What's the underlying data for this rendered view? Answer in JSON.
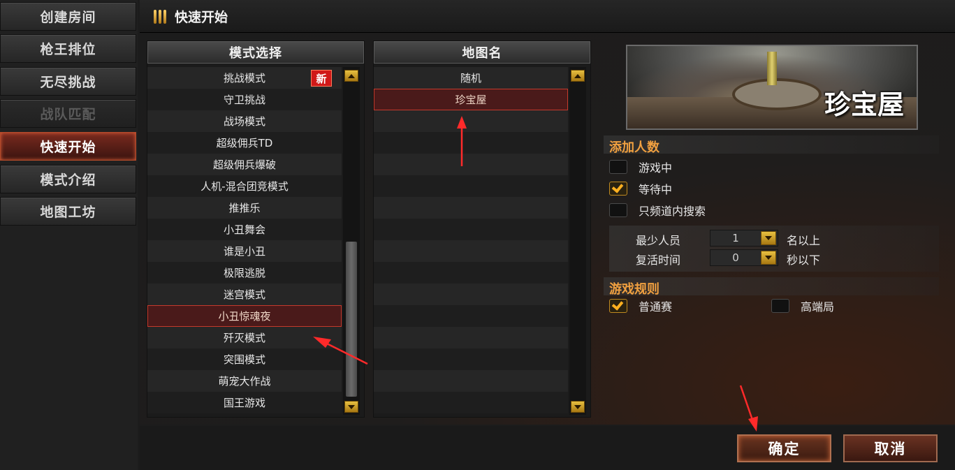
{
  "nav": {
    "items": [
      {
        "label": "创建房间",
        "state": "normal"
      },
      {
        "label": "枪王排位",
        "state": "normal"
      },
      {
        "label": "无尽挑战",
        "state": "normal"
      },
      {
        "label": "战队匹配",
        "state": "disabled"
      },
      {
        "label": "快速开始",
        "state": "active"
      },
      {
        "label": "模式介绍",
        "state": "normal"
      },
      {
        "label": "地图工坊",
        "state": "normal"
      }
    ]
  },
  "header": {
    "title": "快速开始",
    "icon": "bullets-icon"
  },
  "mode_panel": {
    "title": "模式选择",
    "items": [
      "挑战模式",
      "守卫挑战",
      "战场模式",
      "超级佣兵TD",
      "超级佣兵爆破",
      "人机-混合团竞模式",
      "推推乐",
      "小丑舞会",
      "谁是小丑",
      "极限逃脱",
      "迷宫模式",
      "小丑惊魂夜",
      "歼灭模式",
      "突围模式",
      "萌宠大作战",
      "国王游戏"
    ],
    "new_badge": "新",
    "selected": "小丑惊魂夜"
  },
  "map_panel": {
    "title": "地图名",
    "items": [
      "随机",
      "珍宝屋"
    ],
    "selected": "珍宝屋"
  },
  "preview": {
    "map_name": "珍宝屋"
  },
  "add_players": {
    "title": "添加人数",
    "options": [
      {
        "label": "游戏中",
        "checked": false
      },
      {
        "label": "等待中",
        "checked": true
      },
      {
        "label": "只频道内搜索",
        "checked": false
      }
    ],
    "min_players": {
      "label": "最少人员",
      "value": "1",
      "suffix": "名以上"
    },
    "revive_time": {
      "label": "复活时间",
      "value": "0",
      "suffix": "秒以下"
    }
  },
  "game_rules": {
    "title": "游戏规则",
    "options": [
      {
        "label": "普通赛",
        "checked": true
      },
      {
        "label": "高端局",
        "checked": false
      }
    ]
  },
  "footer": {
    "ok_label": "确定",
    "cancel_label": "取消"
  },
  "colors": {
    "accent_orange": "#f0a040",
    "selection_red": "#c43a2c",
    "active_nav": "#7a2a1e"
  }
}
